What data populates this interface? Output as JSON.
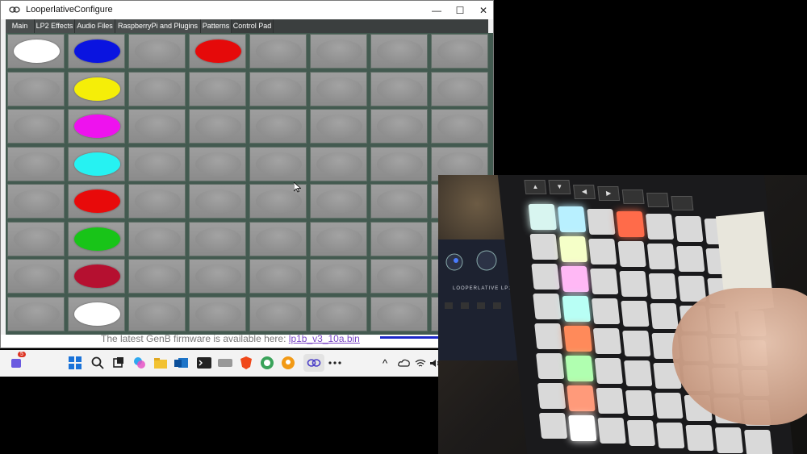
{
  "window": {
    "title": "LooperlativeConfigure",
    "controls": {
      "minimize": "—",
      "maximize": "☐",
      "close": "✕"
    }
  },
  "tabs": [
    {
      "label": "Main"
    },
    {
      "label": "LP2 Effects"
    },
    {
      "label": "Audio Files"
    },
    {
      "label": "RaspberryPi and Plugins"
    },
    {
      "label": "Patterns"
    },
    {
      "label": "Control Pad"
    }
  ],
  "pad_grid": {
    "rows": 8,
    "cols": 8,
    "lit": [
      {
        "row": 0,
        "col": 0,
        "color": "#ffffff"
      },
      {
        "row": 0,
        "col": 1,
        "color": "#0a14e0"
      },
      {
        "row": 0,
        "col": 3,
        "color": "#e50a0a"
      },
      {
        "row": 1,
        "col": 1,
        "color": "#f5ee08"
      },
      {
        "row": 2,
        "col": 1,
        "color": "#ee12ee"
      },
      {
        "row": 3,
        "col": 1,
        "color": "#26f2f2"
      },
      {
        "row": 4,
        "col": 1,
        "color": "#e80a0a"
      },
      {
        "row": 5,
        "col": 1,
        "color": "#18c418"
      },
      {
        "row": 6,
        "col": 1,
        "color": "#b51030"
      },
      {
        "row": 7,
        "col": 1,
        "color": "#ffffff"
      }
    ],
    "off_color": "#8d8d8d"
  },
  "status": {
    "firmware_text": "The latest GenB firmware is available here:",
    "firmware_link": "lp1b_v3_10a.bin"
  },
  "taskbar": {
    "badge_count": "5",
    "icons": [
      "teams-icon",
      "windows-start-icon",
      "search-icon",
      "task-view-icon",
      "copilot-icon",
      "file-explorer-icon",
      "outlook-icon",
      "terminal-icon",
      "app-icon",
      "brave-icon",
      "app-icon-2",
      "podcast-icon",
      "looperlative-icon",
      "more-icon"
    ],
    "tray": {
      "chevron": "^"
    }
  },
  "camera": {
    "device_label": "LOOPERLATIVE LP1"
  }
}
